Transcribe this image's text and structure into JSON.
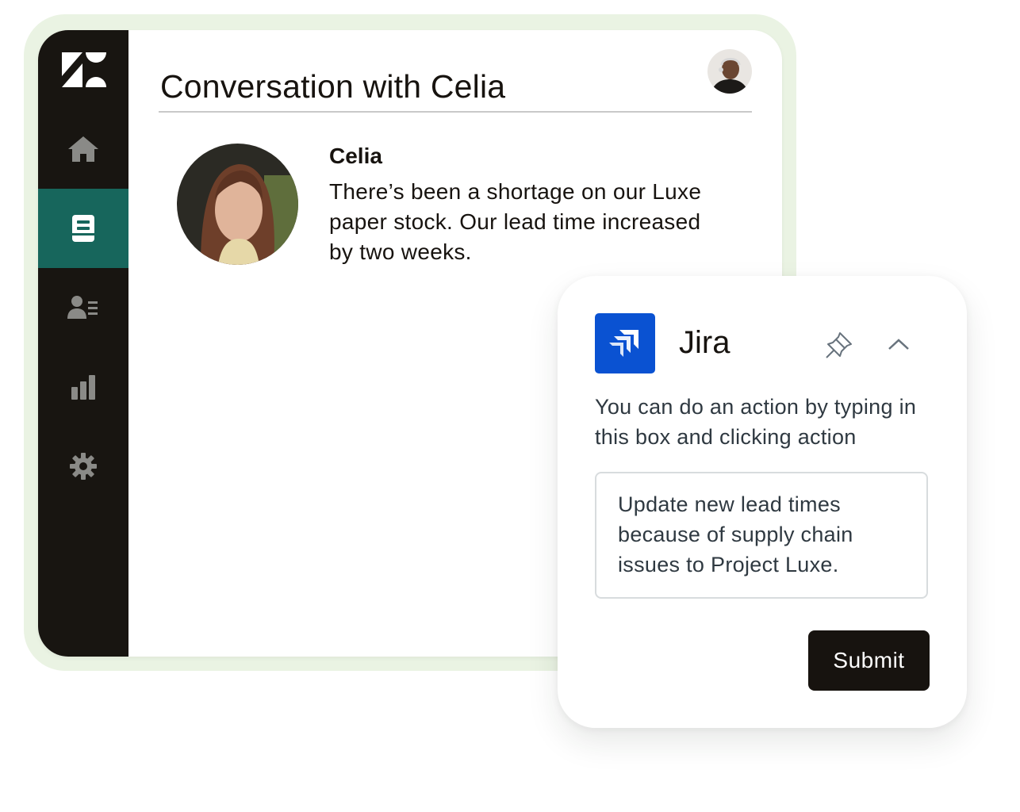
{
  "app": {
    "title": "Conversation with Celia",
    "colors": {
      "sidebar": "#181511",
      "active_nav": "#17665c",
      "frame": "#eaf3e3",
      "text": "#17130f"
    }
  },
  "sidebar": {
    "logo_icon": "zendesk-logo-icon",
    "items": [
      {
        "icon": "home-icon",
        "active": false
      },
      {
        "icon": "tickets-icon",
        "active": true
      },
      {
        "icon": "customers-icon",
        "active": false
      },
      {
        "icon": "reporting-icon",
        "active": false
      },
      {
        "icon": "settings-icon",
        "active": false
      }
    ]
  },
  "conversation": {
    "sender": "Celia",
    "message": "There’s been a shortage on our Luxe paper stock. Our lead time increased by two weeks."
  },
  "jira": {
    "title": "Jira",
    "logo_icon": "jira-logo-icon",
    "pin_icon": "pin-icon",
    "collapse_icon": "chevron-up-icon",
    "help_text": "You can do an action by typing in this box and clicking action",
    "action_value": "Update new lead times because of supply chain issues to Project Luxe.",
    "submit_label": "Submit"
  }
}
